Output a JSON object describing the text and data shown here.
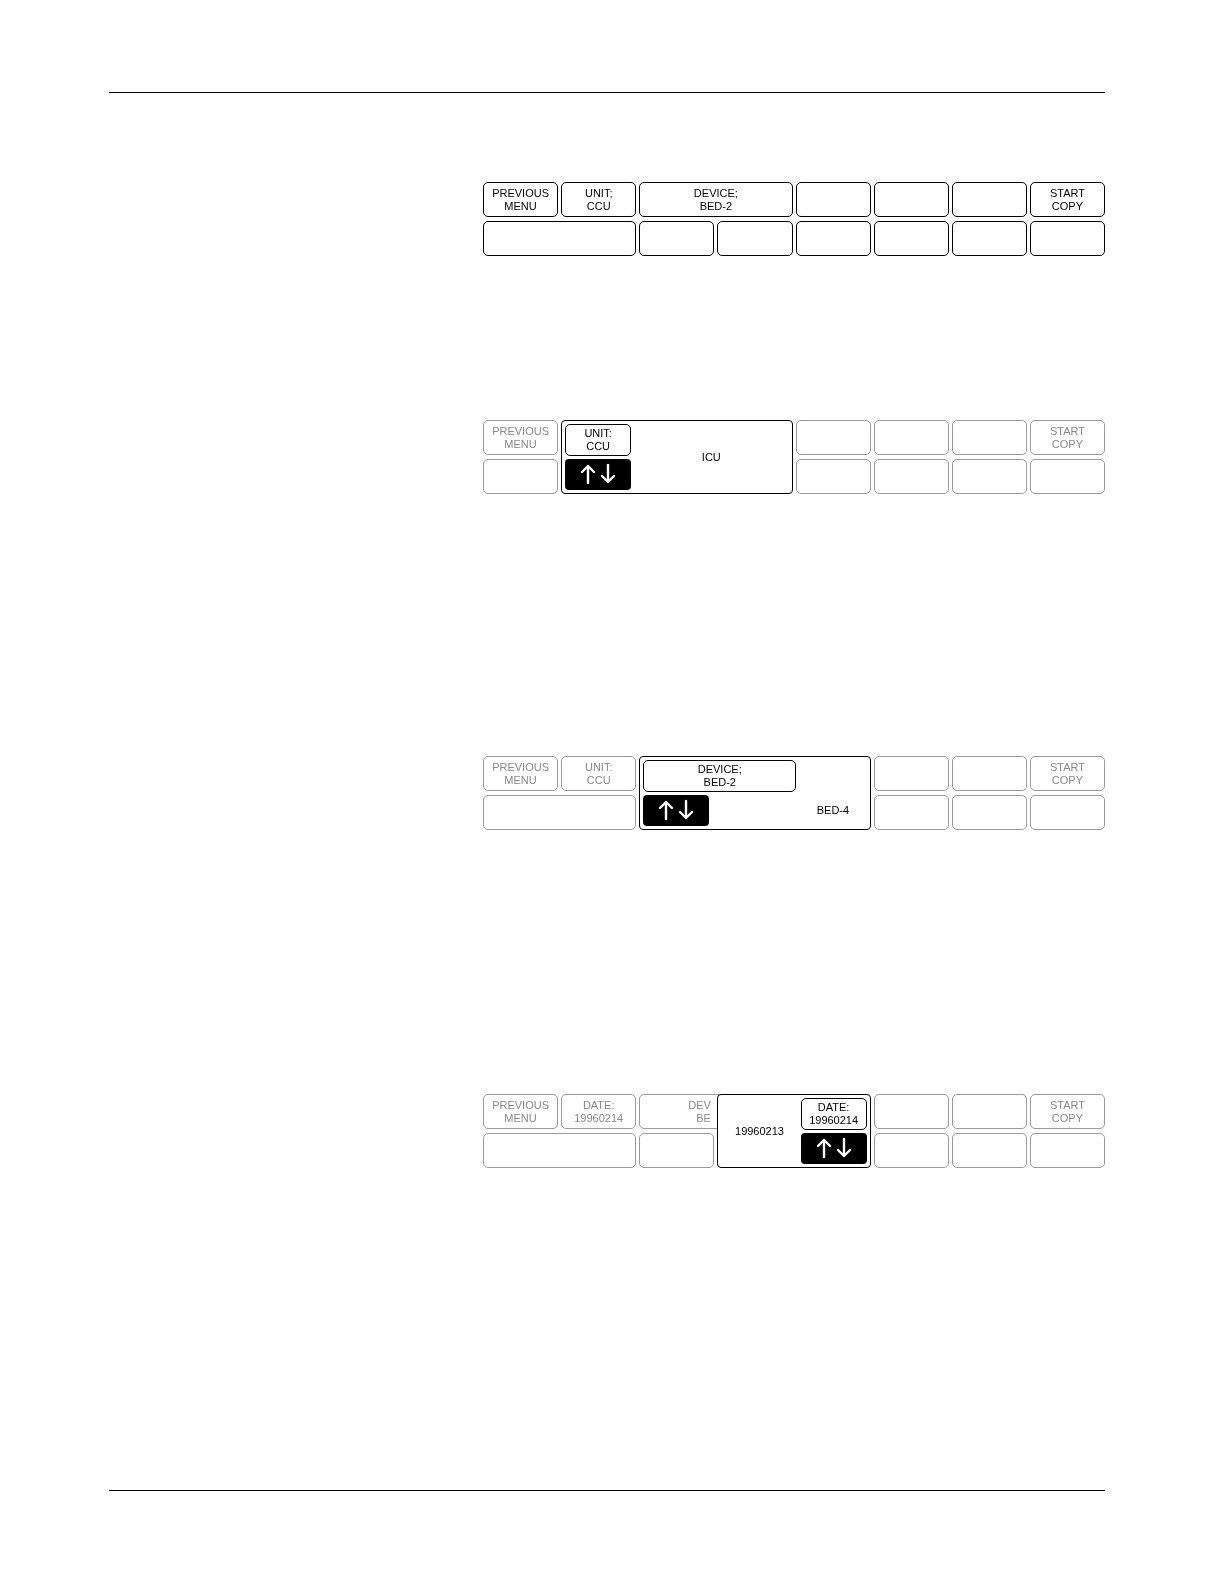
{
  "panels": [
    {
      "dimmed": false,
      "rows": [
        [
          {
            "kind": "key",
            "lines": [
              "PREVIOUS",
              "MENU"
            ]
          },
          {
            "kind": "key",
            "lines": [
              "UNIT;",
              "CCU"
            ]
          },
          {
            "kind": "key",
            "wide": true,
            "lines": [
              "DEVICE;",
              "BED-2"
            ]
          },
          {
            "kind": "key"
          },
          {
            "kind": "key"
          },
          {
            "kind": "key"
          },
          {
            "kind": "key",
            "lines": [
              "START",
              "COPY"
            ]
          }
        ],
        [
          {
            "kind": "key",
            "wide": true
          },
          {
            "kind": "key"
          },
          {
            "kind": "key"
          },
          {
            "kind": "key"
          },
          {
            "kind": "key"
          },
          {
            "kind": "key"
          },
          {
            "kind": "key"
          }
        ]
      ]
    },
    {
      "dimmed": true,
      "rows": [
        [
          {
            "kind": "key",
            "lines": [
              "PREVIOUS",
              "MENU"
            ]
          },
          {
            "kind": "popup",
            "wide": true,
            "controls_right": false,
            "key": {
              "wide": false,
              "lines": [
                "UNIT:",
                "CCU"
              ]
            },
            "value": "ICU"
          },
          {
            "kind": "key"
          },
          {
            "kind": "key"
          },
          {
            "kind": "key"
          },
          {
            "kind": "key",
            "lines": [
              "START",
              "COPY"
            ]
          }
        ],
        [
          {
            "kind": "key"
          },
          {
            "kind": "key"
          },
          {
            "kind": "key"
          },
          {
            "kind": "key"
          },
          {
            "kind": "key"
          }
        ]
      ]
    },
    {
      "dimmed": true,
      "rows": [
        [
          {
            "kind": "key",
            "lines": [
              "PREVIOUS",
              "MENU"
            ]
          },
          {
            "kind": "key",
            "lines": [
              "UNIT:",
              "CCU"
            ]
          },
          {
            "kind": "popup",
            "wide": true,
            "controls_right": false,
            "key": {
              "wide": true,
              "lines": [
                "DEVICE;",
                "BED-2"
              ]
            },
            "value": "BED-4"
          },
          {
            "kind": "key"
          },
          {
            "kind": "key"
          },
          {
            "kind": "key",
            "lines": [
              "START",
              "COPY"
            ]
          }
        ],
        [
          {
            "kind": "key",
            "wide": true
          },
          {
            "kind": "key"
          },
          {
            "kind": "key"
          },
          {
            "kind": "key"
          }
        ]
      ]
    },
    {
      "dimmed": true,
      "rows": [
        [
          {
            "kind": "key",
            "lines": [
              "PREVIOUS",
              "MENU"
            ]
          },
          {
            "kind": "key",
            "lines": [
              "DATE:",
              "19960214"
            ]
          },
          {
            "kind": "key",
            "wide": true,
            "covered": true,
            "lines": [
              "DEV",
              "BE"
            ]
          },
          {
            "kind": "popup",
            "wide": false,
            "overlaps": true,
            "controls_right": true,
            "key": {
              "wide": false,
              "lines": [
                "DATE:",
                "19960214"
              ]
            },
            "value": "19960213"
          },
          {
            "kind": "key"
          },
          {
            "kind": "key"
          },
          {
            "kind": "key",
            "lines": [
              "START",
              "COPY"
            ]
          }
        ],
        [
          {
            "kind": "key",
            "wide": true
          },
          {
            "kind": "key"
          },
          {
            "kind": "key"
          },
          {
            "kind": "key"
          },
          {
            "kind": "key"
          }
        ]
      ]
    }
  ]
}
